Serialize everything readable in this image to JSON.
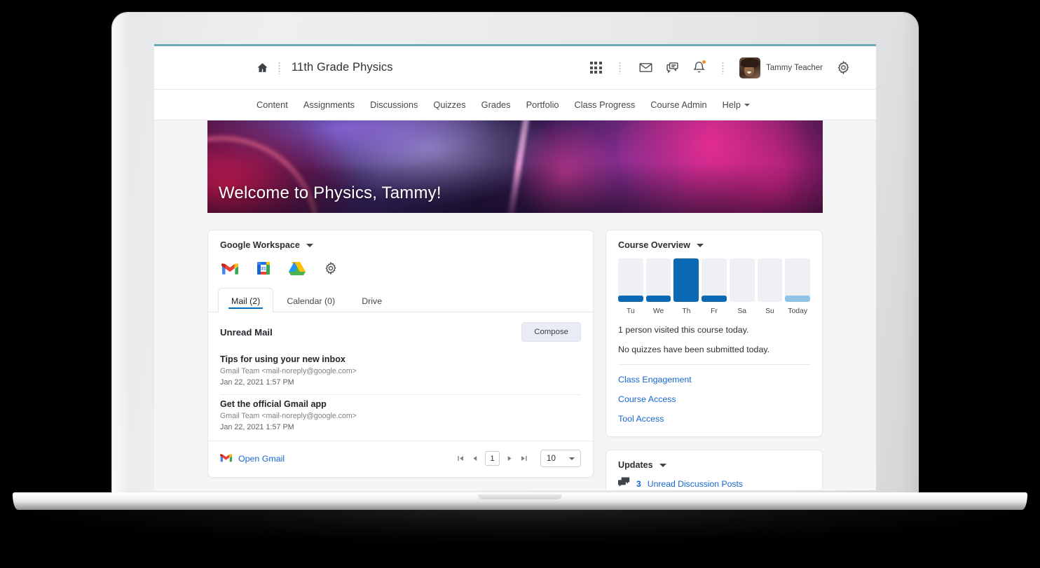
{
  "header": {
    "home_icon": "home-icon",
    "course_title": "11th Grade Physics",
    "waffle_icon": "apps-grid-icon",
    "mail_icon": "envelope-icon",
    "messages_icon": "chat-bubbles-icon",
    "alerts_icon": "bell-icon",
    "user_name": "Tammy Teacher",
    "settings_icon": "gear-icon"
  },
  "navbar": {
    "items": [
      {
        "label": "Content"
      },
      {
        "label": "Assignments"
      },
      {
        "label": "Discussions"
      },
      {
        "label": "Quizzes"
      },
      {
        "label": "Grades"
      },
      {
        "label": "Portfolio"
      },
      {
        "label": "Class Progress"
      },
      {
        "label": "Course Admin"
      },
      {
        "label": "Help"
      }
    ]
  },
  "banner": {
    "title": "Welcome to Physics, Tammy!"
  },
  "google_widget": {
    "title": "Google Workspace",
    "apps": [
      {
        "name": "gmail-icon",
        "label": "Gmail"
      },
      {
        "name": "google-calendar-icon",
        "label": "Calendar"
      },
      {
        "name": "google-drive-icon",
        "label": "Drive"
      },
      {
        "name": "gear-icon",
        "label": "Settings"
      }
    ],
    "tabs": [
      {
        "label": "Mail (2)",
        "active": true
      },
      {
        "label": "Calendar (0)",
        "active": false
      },
      {
        "label": "Drive",
        "active": false
      }
    ],
    "mail": {
      "section_title": "Unread Mail",
      "compose_label": "Compose",
      "items": [
        {
          "subject": "Tips for using your new inbox",
          "from": "Gmail Team <mail-noreply@google.com>",
          "date": "Jan 22, 2021 1:57 PM"
        },
        {
          "subject": "Get the official Gmail app",
          "from": "Gmail Team <mail-noreply@google.com>",
          "date": "Jan 22, 2021 1:57 PM"
        }
      ],
      "open_link": "Open Gmail",
      "pager": {
        "first_icon": "first-page-icon",
        "prev_icon": "previous-page-icon",
        "current_page": "1",
        "next_icon": "next-page-icon",
        "last_icon": "last-page-icon",
        "page_size": "10"
      }
    }
  },
  "course_overview": {
    "title": "Course Overview",
    "visits_line": "1 person visited this course today.",
    "quizzes_line": "No quizzes have been submitted today.",
    "links": [
      {
        "label": "Class Engagement"
      },
      {
        "label": "Course Access"
      },
      {
        "label": "Tool Access"
      }
    ]
  },
  "updates": {
    "title": "Updates",
    "icon": "discussion-posts-icon",
    "count": "3",
    "label": "Unread Discussion Posts"
  },
  "colors": {
    "accent_blue": "#006fbf",
    "link_blue": "#1666d0",
    "bar_dark": "#0b69b4",
    "bar_light": "#8fc4e8",
    "bar_track": "#eef0f3",
    "page_bg": "#f4f5f7",
    "top_accent": "#6aa9b8",
    "alert_dot": "#f68a1e"
  },
  "chart_data": {
    "type": "bar",
    "title": "Course Overview",
    "categories": [
      "Tu",
      "We",
      "Th",
      "Fr",
      "Sa",
      "Su",
      "Today"
    ],
    "values": [
      15,
      15,
      100,
      15,
      0,
      0,
      15
    ],
    "colors": [
      "#0b69b4",
      "#0b69b4",
      "#0b69b4",
      "#0b69b4",
      "#0b69b4",
      "#0b69b4",
      "#8fc4e8"
    ],
    "xlabel": "",
    "ylabel": "",
    "ylim": [
      0,
      100
    ],
    "grid": false,
    "legend": false
  }
}
